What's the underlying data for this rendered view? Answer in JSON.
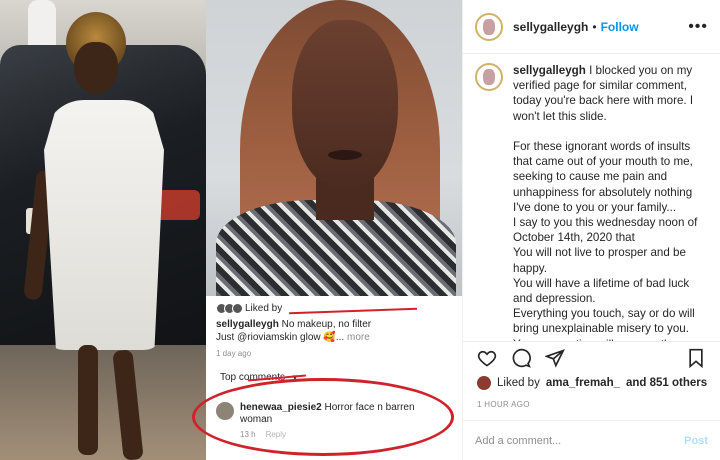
{
  "post": {
    "username": "sellygalleygh",
    "follow_label": "Follow",
    "separator": "•",
    "more_label": "•••",
    "caption": "I blocked you on my verified page for similar comment, today you're back here with more. I won't let this slide.\n\nFor these ignorant words of insults that came out of your mouth to me, seeking to cause me pain and unhappiness for absolutely nothing I've done to you or your family...\nI say to you this wednesday noon of October 14th, 2020 that\nYou will not live to prosper and be happy.\nYou will have a lifetime of bad luck and depression.\nEverything you touch, say or do will bring unexplainable misery to you.\nYour generation will pass on the curse of infertility, unhappiness, madness",
    "liked_by_prefix": "Liked by",
    "liked_by_user": "ama_fremah_",
    "liked_by_suffix": "and 851 others",
    "posted_time": "1 HOUR AGO",
    "comment_placeholder": "Add a comment...",
    "post_button": "Post"
  },
  "screenshot": {
    "liked_prefix": "Liked by",
    "username": "sellygalleygh",
    "caption_line1": "No makeup, no filter",
    "caption_line2": "Just @rioviamskin glow 🥰...",
    "more": "more",
    "time": "1 day ago",
    "top_comments": "Top comments",
    "comment_user": "henewaa_piesie2",
    "comment_text": "Horror face n barren woman",
    "comment_time": "13 h",
    "comment_reply": "Reply"
  },
  "icons": {
    "heart": "heart-icon",
    "comment": "comment-icon",
    "share": "share-icon",
    "save": "bookmark-icon"
  },
  "colors": {
    "link_blue": "#0095f6",
    "annotation_red": "#d0222b"
  }
}
